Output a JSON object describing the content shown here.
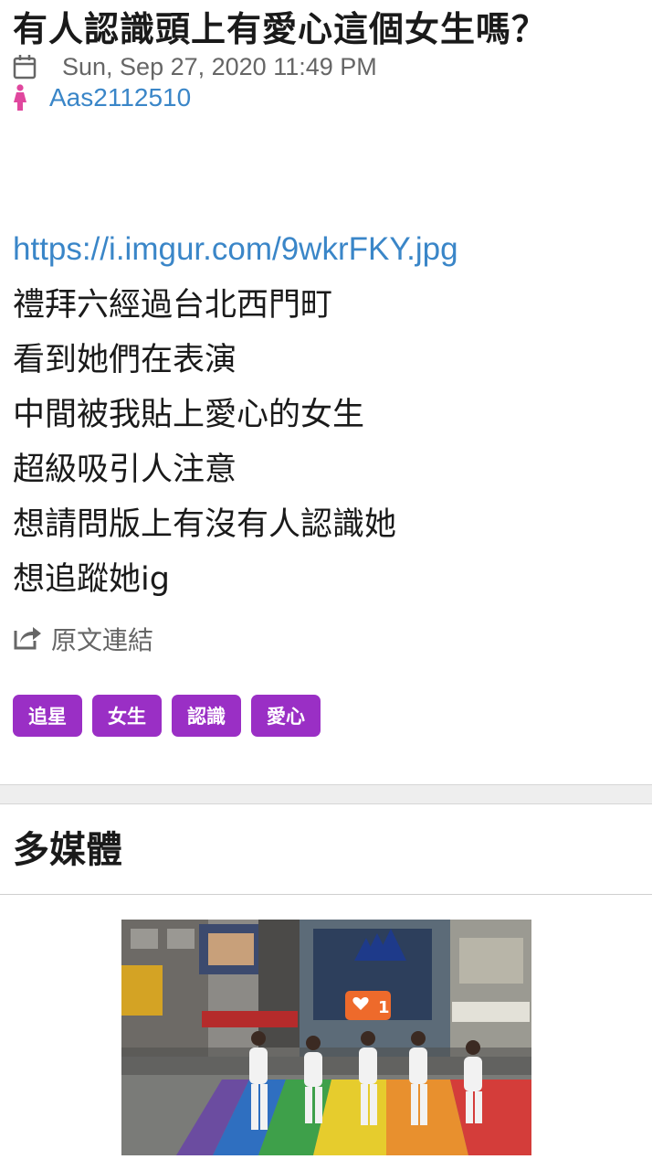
{
  "post": {
    "title": "有人認識頭上有愛心這個女生嗎？",
    "date": "Sun, Sep 27, 2020 11:49 PM",
    "author": "Aas2112510",
    "link": "https://i.imgur.com/9wkrFKY.jpg",
    "lines": [
      "禮拜六經過台北西門町",
      "看到她們在表演",
      "中間被我貼上愛心的女生",
      "超級吸引人注意",
      "想請問版上有沒有人認識她",
      "想追蹤她ig"
    ],
    "source_label": "原文連結",
    "tags": [
      "追星",
      "女生",
      "認識",
      "愛心"
    ]
  },
  "media_section": {
    "title": "多媒體",
    "like_count": "1"
  },
  "colors": {
    "tag_bg": "#9a2fc5",
    "link": "#3a86c8",
    "author_icon": "#e0479e"
  }
}
